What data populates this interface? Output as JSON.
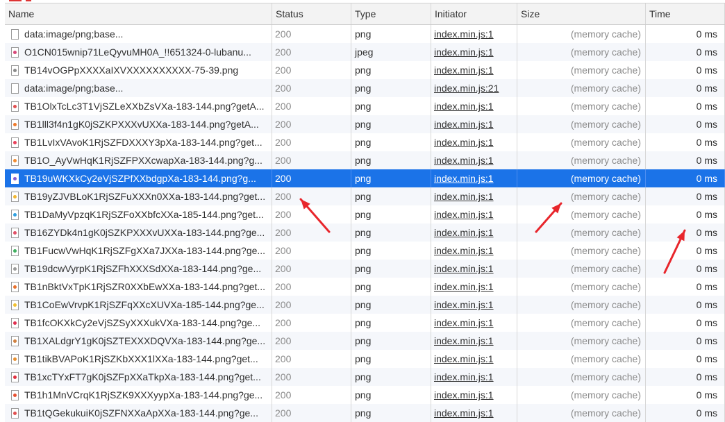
{
  "columns": {
    "name": "Name",
    "status": "Status",
    "type": "Type",
    "initiator": "Initiator",
    "size": "Size",
    "time": "Time"
  },
  "accent_color": "#1b73e8",
  "annotation_color": "#e8262c",
  "rows": [
    {
      "name": "data:image/png;base...",
      "status": "200",
      "type": "png",
      "initiator": "index.min.js:1",
      "size": "(memory cache)",
      "time": "0 ms",
      "icon": "blank-file-icon",
      "icon_color": ""
    },
    {
      "name": "O1CN015wnip71LeQyvuMH0A_!!651324-0-lubanu...",
      "status": "200",
      "type": "jpeg",
      "initiator": "index.min.js:1",
      "size": "(memory cache)",
      "time": "0 ms",
      "icon": "image-file-icon",
      "icon_color": "#d6487a"
    },
    {
      "name": "TB14vOGPpXXXXaIXVXXXXXXXXXX-75-39.png",
      "status": "200",
      "type": "png",
      "initiator": "index.min.js:1",
      "size": "(memory cache)",
      "time": "0 ms",
      "icon": "image-file-icon",
      "icon_color": "#8a8a8a"
    },
    {
      "name": "data:image/png;base...",
      "status": "200",
      "type": "png",
      "initiator": "index.min.js:21",
      "size": "(memory cache)",
      "time": "0 ms",
      "icon": "blank-file-icon",
      "icon_color": ""
    },
    {
      "name": "TB1OlxTcLc3T1VjSZLeXXbZsVXa-183-144.png?getA...",
      "status": "200",
      "type": "png",
      "initiator": "index.min.js:1",
      "size": "(memory cache)",
      "time": "0 ms",
      "icon": "image-file-icon",
      "icon_color": "#e05050"
    },
    {
      "name": "TB1lll3f4n1gK0jSZKPXXXvUXXa-183-144.png?getA...",
      "status": "200",
      "type": "png",
      "initiator": "index.min.js:1",
      "size": "(memory cache)",
      "time": "0 ms",
      "icon": "image-file-icon",
      "icon_color": "#ef7a2a"
    },
    {
      "name": "TB1LvIxVAvoK1RjSZFDXXXY3pXa-183-144.png?get...",
      "status": "200",
      "type": "png",
      "initiator": "index.min.js:1",
      "size": "(memory cache)",
      "time": "0 ms",
      "icon": "image-file-icon",
      "icon_color": "#e8405a"
    },
    {
      "name": "TB1O_AyVwHqK1RjSZFPXXcwapXa-183-144.png?g...",
      "status": "200",
      "type": "png",
      "initiator": "index.min.js:1",
      "size": "(memory cache)",
      "time": "0 ms",
      "icon": "image-file-icon",
      "icon_color": "#f08a30"
    },
    {
      "name": "TB19uWKXkCy2eVjSZPfXXbdgpXa-183-144.png?g...",
      "status": "200",
      "type": "png",
      "initiator": "index.min.js:1",
      "size": "(memory cache)",
      "time": "0 ms",
      "icon": "image-file-icon",
      "icon_color": "#8a5cd0",
      "selected": true
    },
    {
      "name": "TB19yZJVBLoK1RjSZFuXXXn0XXa-183-144.png?get...",
      "status": "200",
      "type": "png",
      "initiator": "index.min.js:1",
      "size": "(memory cache)",
      "time": "0 ms",
      "icon": "image-file-icon",
      "icon_color": "#f2b630"
    },
    {
      "name": "TB1DaMyVpzqK1RjSZFoXXbfcXXa-185-144.png?get...",
      "status": "200",
      "type": "png",
      "initiator": "index.min.js:1",
      "size": "(memory cache)",
      "time": "0 ms",
      "icon": "image-file-icon",
      "icon_color": "#30a0e0"
    },
    {
      "name": "TB16ZYDk4n1gK0jSZKPXXXvUXXa-183-144.png?ge...",
      "status": "200",
      "type": "png",
      "initiator": "index.min.js:1",
      "size": "(memory cache)",
      "time": "0 ms",
      "icon": "image-file-icon",
      "icon_color": "#e05068"
    },
    {
      "name": "TB1FucwVwHqK1RjSZFgXXa7JXXa-183-144.png?ge...",
      "status": "200",
      "type": "png",
      "initiator": "index.min.js:1",
      "size": "(memory cache)",
      "time": "0 ms",
      "icon": "image-file-icon",
      "icon_color": "#40b060"
    },
    {
      "name": "TB19dcwVyrpK1RjSZFhXXXSdXXa-183-144.png?ge...",
      "status": "200",
      "type": "png",
      "initiator": "index.min.js:1",
      "size": "(memory cache)",
      "time": "0 ms",
      "icon": "image-file-icon",
      "icon_color": "#9a9a9a"
    },
    {
      "name": "TB1nBktVxTpK1RjSZR0XXbEwXXa-183-144.png?get...",
      "status": "200",
      "type": "png",
      "initiator": "index.min.js:1",
      "size": "(memory cache)",
      "time": "0 ms",
      "icon": "image-file-icon",
      "icon_color": "#e8702a"
    },
    {
      "name": "TB1CoEwVrvpK1RjSZFqXXcXUVXa-185-144.png?ge...",
      "status": "200",
      "type": "png",
      "initiator": "index.min.js:1",
      "size": "(memory cache)",
      "time": "0 ms",
      "icon": "image-file-icon",
      "icon_color": "#f2c030"
    },
    {
      "name": "TB1fcOKXkCy2eVjSZSyXXXukVXa-183-144.png?ge...",
      "status": "200",
      "type": "png",
      "initiator": "index.min.js:1",
      "size": "(memory cache)",
      "time": "0 ms",
      "icon": "image-file-icon",
      "icon_color": "#e03050"
    },
    {
      "name": "TB1XALdgrY1gK0jSZTEXXXDQVXa-183-144.png?ge...",
      "status": "200",
      "type": "png",
      "initiator": "index.min.js:1",
      "size": "(memory cache)",
      "time": "0 ms",
      "icon": "image-file-icon",
      "icon_color": "#d08040"
    },
    {
      "name": "TB1tikBVAPoK1RjSZKbXXX1lXXa-183-144.png?get...",
      "status": "200",
      "type": "png",
      "initiator": "index.min.js:1",
      "size": "(memory cache)",
      "time": "0 ms",
      "icon": "image-file-icon",
      "icon_color": "#e89030"
    },
    {
      "name": "TB1xcTYxFT7gK0jSZFpXXaTkpXa-183-144.png?get...",
      "status": "200",
      "type": "png",
      "initiator": "index.min.js:1",
      "size": "(memory cache)",
      "time": "0 ms",
      "icon": "image-file-icon",
      "icon_color": "#e03040"
    },
    {
      "name": "TB1h1MnVCrqK1RjSZK9XXXyypXa-183-144.png?ge...",
      "status": "200",
      "type": "png",
      "initiator": "index.min.js:1",
      "size": "(memory cache)",
      "time": "0 ms",
      "icon": "image-file-icon",
      "icon_color": "#e85030"
    },
    {
      "name": "TB1tQGekukuiK0jSZFNXXaApXXa-183-144.png?ge...",
      "status": "200",
      "type": "png",
      "initiator": "index.min.js:1",
      "size": "(memory cache)",
      "time": "0 ms",
      "icon": "image-file-icon",
      "icon_color": "#e05050"
    }
  ]
}
